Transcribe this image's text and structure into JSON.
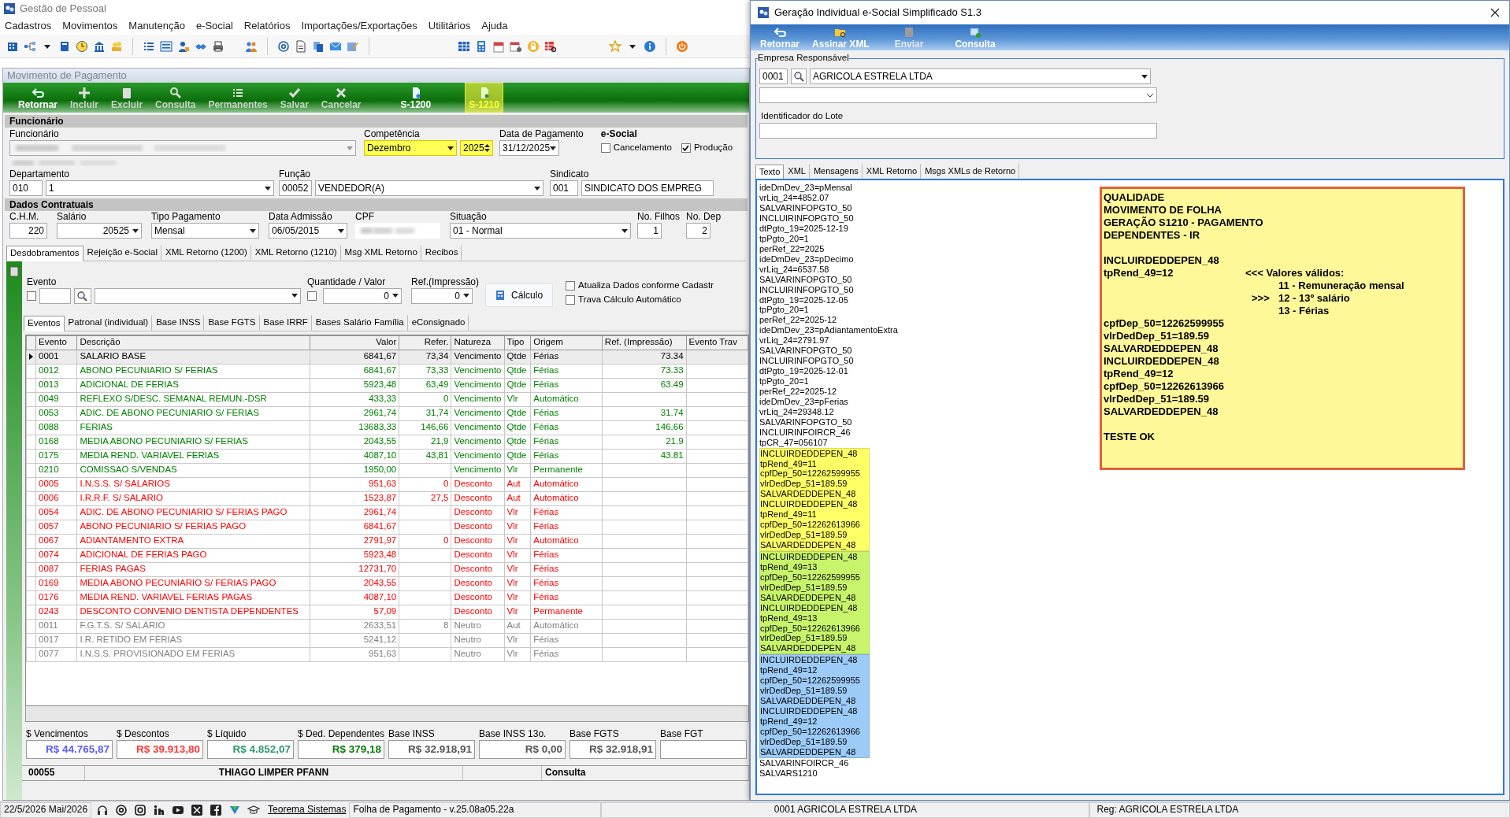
{
  "main_window": {
    "title": "Gestão de Pessoal"
  },
  "menu": [
    "Cadastros",
    "Movimentos",
    "Manutenção",
    "e-Social",
    "Relatórios",
    "Importações/Exportações",
    "Utilitários",
    "Ajuda"
  ],
  "child_window": {
    "title": "Movimento de Pagamento"
  },
  "toolbar": [
    {
      "label": "Retornar",
      "disabled": false,
      "highlighted": false
    },
    {
      "label": "Incluir",
      "disabled": true,
      "highlighted": false
    },
    {
      "label": "Excluir",
      "disabled": true,
      "highlighted": false
    },
    {
      "label": "Consulta",
      "disabled": true,
      "highlighted": false
    },
    {
      "label": "Permanentes",
      "disabled": true,
      "highlighted": false
    },
    {
      "label": "Salvar",
      "disabled": true,
      "highlighted": false
    },
    {
      "label": "Cancelar",
      "disabled": true,
      "highlighted": false
    },
    {
      "label": "S-1200",
      "disabled": false,
      "highlighted": false
    },
    {
      "label": "S-1210",
      "disabled": false,
      "highlighted": true
    }
  ],
  "funcionario": {
    "section": "Funcionário",
    "label": "Funcionário",
    "competencia": {
      "label": "Competência",
      "month": "Dezembro",
      "year": "2025",
      "highlighted": true
    },
    "data_pagamento": {
      "label": "Data de Pagamento",
      "value": "31/12/2025"
    },
    "esocial": {
      "label": "e-Social",
      "options": [
        {
          "label": "Cancelamento",
          "checked": false
        },
        {
          "label": "Produção",
          "checked": true
        }
      ]
    }
  },
  "lotacao": {
    "departamento": {
      "label": "Departamento",
      "code": "010",
      "name": "1"
    },
    "funcao": {
      "label": "Função",
      "code": "00052",
      "name": "VENDEDOR(A)"
    },
    "sindicato": {
      "label": "Sindicato",
      "code": "001",
      "name": "SINDICATO DOS EMPREG"
    }
  },
  "contrato": {
    "section": "Dados Contratuais",
    "chm": {
      "label": "C.H.M.",
      "value": "220"
    },
    "salario": {
      "label": "Salário",
      "value": "20525"
    },
    "tipo_pagamento": {
      "label": "Tipo Pagamento",
      "value": "Mensal"
    },
    "data_admissao": {
      "label": "Data Admissão",
      "value": "06/05/2015"
    },
    "cpf": {
      "label": "CPF"
    },
    "situacao": {
      "label": "Situação",
      "value": "01 - Normal"
    },
    "filhos": {
      "label": "No. Filhos",
      "value": "1"
    },
    "dependentes": {
      "label": "No. Dep",
      "value": "2"
    }
  },
  "tabs": [
    {
      "label": "Desdobramentos",
      "selected": true
    },
    {
      "label": "Rejeição e-Social",
      "selected": false
    },
    {
      "label": "XML Retorno (1200)",
      "selected": false
    },
    {
      "label": "XML Retorno (1210)",
      "selected": false
    },
    {
      "label": "Msg XML Retorno",
      "selected": false
    },
    {
      "label": "Recibos",
      "selected": false
    }
  ],
  "evento_panel": {
    "evento_label": "Evento",
    "evento_checked": false,
    "quantidade_label": "Quantidade / Valor",
    "quantidade_checked": false,
    "quantidade": "0",
    "ref_label": "Ref.(Impressão)",
    "ref": "0",
    "calc_button": "Cálculo",
    "options": [
      {
        "label": "Atualiza Dados conforme Cadastr",
        "checked": false
      },
      {
        "label": "Trava Cálculo Automático",
        "checked": false
      }
    ]
  },
  "sub_tabs": [
    {
      "label": "Eventos",
      "selected": true
    },
    {
      "label": "Patronal (individual)",
      "selected": false
    },
    {
      "label": "Base INSS",
      "selected": false
    },
    {
      "label": "Base FGTS",
      "selected": false
    },
    {
      "label": "Base IRRF",
      "selected": false
    },
    {
      "label": "Bases Salário Família",
      "selected": false
    },
    {
      "label": "eConsignado",
      "selected": false
    }
  ],
  "table": {
    "columns": [
      "Evento",
      "Descrição",
      "Valor",
      "Refer.",
      "Natureza",
      "Tipo",
      "Origem",
      "Ref. (Impressão)",
      "Evento Trav"
    ],
    "rows": [
      {
        "evento": "0001",
        "descricao": "SALARIO BASE",
        "valor": "6841,67",
        "refer": "73,34",
        "natureza": "Vencimento",
        "tipo": "Qtde",
        "origem": "Férias",
        "ref_impressao": "73.34",
        "color": "#000000",
        "selected": true
      },
      {
        "evento": "0012",
        "descricao": "ABONO PECUNIARIO S/ FERIAS",
        "valor": "6841,67",
        "refer": "73,33",
        "natureza": "Vencimento",
        "tipo": "Qtde",
        "origem": "Férias",
        "ref_impressao": "73.33",
        "color": "#008000",
        "selected": false
      },
      {
        "evento": "0013",
        "descricao": "ADICIONAL DE FERIAS",
        "valor": "5923,48",
        "refer": "63,49",
        "natureza": "Vencimento",
        "tipo": "Qtde",
        "origem": "Férias",
        "ref_impressao": "63.49",
        "color": "#008000",
        "selected": false
      },
      {
        "evento": "0049",
        "descricao": "REFLEXO S/DESC. SEMANAL REMUN.-DSR",
        "valor": "433,33",
        "refer": "0",
        "natureza": "Vencimento",
        "tipo": "Vlr",
        "origem": "Automático",
        "color": "#008000",
        "selected": false
      },
      {
        "evento": "0053",
        "descricao": "ADIC. DE ABONO PECUNIARIO S/ FERIAS",
        "valor": "2961,74",
        "refer": "31,74",
        "natureza": "Vencimento",
        "tipo": "Qtde",
        "origem": "Férias",
        "ref_impressao": "31.74",
        "color": "#008000",
        "selected": false
      },
      {
        "evento": "0088",
        "descricao": "FERIAS",
        "valor": "13683,33",
        "refer": "146,66",
        "natureza": "Vencimento",
        "tipo": "Qtde",
        "origem": "Férias",
        "ref_impressao": "146.66",
        "color": "#008000",
        "selected": false
      },
      {
        "evento": "0168",
        "descricao": "MEDIA ABONO PECUNIARIO S/ FERIAS",
        "valor": "2043,55",
        "refer": "21,9",
        "natureza": "Vencimento",
        "tipo": "Qtde",
        "origem": "Férias",
        "ref_impressao": "21.9",
        "color": "#008000",
        "selected": false
      },
      {
        "evento": "0175",
        "descricao": "MEDIA REND. VARIAVEL  FERIAS",
        "valor": "4087,10",
        "refer": "43,81",
        "natureza": "Vencimento",
        "tipo": "Qtde",
        "origem": "Férias",
        "ref_impressao": "43.81",
        "color": "#008000",
        "selected": false
      },
      {
        "evento": "0210",
        "descricao": "COMISSAO S/VENDAS",
        "valor": "1950,00",
        "natureza": "Vencimento",
        "tipo": "Vlr",
        "origem": "Permanente",
        "color": "#008000",
        "selected": false
      },
      {
        "evento": "0005",
        "descricao": "I.N.S.S. S/ SALARIOS",
        "valor": "951,63",
        "refer": "0",
        "natureza": "Desconto",
        "tipo": "Aut",
        "origem": "Automático",
        "color": "#ff0000",
        "selected": false
      },
      {
        "evento": "0006",
        "descricao": "I.R.R.F. S/ SALARIO",
        "valor": "1523,87",
        "refer": "27,5",
        "natureza": "Desconto",
        "tipo": "Aut",
        "origem": "Automático",
        "color": "#ff0000",
        "selected": false
      },
      {
        "evento": "0054",
        "descricao": "ADIC. DE ABONO PECUNIARIO S/ FERIAS PAGO",
        "valor": "2961,74",
        "natureza": "Desconto",
        "tipo": "Vlr",
        "origem": "Férias",
        "color": "#ff0000",
        "selected": false
      },
      {
        "evento": "0057",
        "descricao": "ABONO PECUNIARIO S/ FERIAS PAGO",
        "valor": "6841,67",
        "natureza": "Desconto",
        "tipo": "Vlr",
        "origem": "Férias",
        "color": "#ff0000",
        "selected": false
      },
      {
        "evento": "0067",
        "descricao": "ADIANTAMENTO EXTRA",
        "valor": "2791,97",
        "refer": "0",
        "natureza": "Desconto",
        "tipo": "Vlr",
        "origem": "Automático",
        "color": "#ff0000",
        "selected": false
      },
      {
        "evento": "0074",
        "descricao": "ADICIONAL DE FERIAS PAGO",
        "valor": "5923,48",
        "natureza": "Desconto",
        "tipo": "Vlr",
        "origem": "Férias",
        "color": "#ff0000",
        "selected": false
      },
      {
        "evento": "0087",
        "descricao": "FERIAS PAGAS",
        "valor": "12731,70",
        "natureza": "Desconto",
        "tipo": "Vlr",
        "origem": "Férias",
        "color": "#ff0000",
        "selected": false
      },
      {
        "evento": "0169",
        "descricao": "MEDIA ABONO PECUNIARIO S/ FERIAS PAGO",
        "valor": "2043,55",
        "natureza": "Desconto",
        "tipo": "Vlr",
        "origem": "Férias",
        "color": "#ff0000",
        "selected": false
      },
      {
        "evento": "0176",
        "descricao": "MEDIA REND. VARIAVEL  FERIAS PAGAS",
        "valor": "4087,10",
        "natureza": "Desconto",
        "tipo": "Vlr",
        "origem": "Férias",
        "color": "#ff0000",
        "selected": false
      },
      {
        "evento": "0243",
        "descricao": "DESCONTO CONVENIO DENTISTA DEPENDENTES",
        "valor": "57,09",
        "natureza": "Desconto",
        "tipo": "Vlr",
        "origem": "Permanente",
        "color": "#ff0000",
        "selected": false
      },
      {
        "evento": "0011",
        "descricao": "F.G.T.S. S/ SALÁRIO",
        "valor": "2633,51",
        "refer": "8",
        "natureza": "Neutro",
        "tipo": "Aut",
        "origem": "Automático",
        "color": "#808080",
        "selected": false
      },
      {
        "evento": "0017",
        "descricao": "I.R. RETIDO EM FÉRIAS",
        "valor": "5241,12",
        "natureza": "Neutro",
        "tipo": "Vlr",
        "origem": "Férias",
        "color": "#808080",
        "selected": false
      },
      {
        "evento": "0077",
        "descricao": "I.N.S.S. PROVISIONADO EM FERIAS",
        "valor": "951,63",
        "natureza": "Neutro",
        "tipo": "Vlr",
        "origem": "Férias",
        "color": "#808080",
        "selected": false
      }
    ]
  },
  "totals": [
    {
      "label": "$ Vencimentos",
      "value": "R$ 44.765,87",
      "color": "#5b5bff"
    },
    {
      "label": "$ Descontos",
      "value": "R$ 39.913,80",
      "color": "#ff3b3b"
    },
    {
      "label": "$ Líquido",
      "value": "R$ 4.852,07",
      "color": "#2f9a6c"
    },
    {
      "label": "$ Ded. Dependentes",
      "value": "R$ 379,18",
      "color": "#0a7a0a"
    },
    {
      "label": "Base INSS",
      "value": "R$ 32.918,91",
      "color": "#555555"
    },
    {
      "label": "Base INSS 13o.",
      "value": "R$ 0,00",
      "color": "#555555"
    },
    {
      "label": "Base FGTS",
      "value": "R$ 32.918,91",
      "color": "#555555"
    },
    {
      "label": "Base FGT"
    }
  ],
  "employee_bar": {
    "code": "00055",
    "name": "THIAGO LIMPER PFANN",
    "mode": "Consulta"
  },
  "status_bar": {
    "date": "22/5/2026 Mai/2026",
    "link": "Teorema Sistemas",
    "version": "Folha de Pagamento - v.25.08a05.22a",
    "company": "0001 AGRICOLA ESTRELA LTDA",
    "reg": "Reg: AGRICOLA ESTRELA LTDA"
  },
  "dialog": {
    "title": "Geração Individual e-Social Simplificado S1.3",
    "toolbar": [
      {
        "label": "Retornar",
        "disabled": false
      },
      {
        "label": "Assinar XML",
        "disabled": false
      },
      {
        "label": "Enviar",
        "disabled": true
      },
      {
        "label": "Consulta",
        "disabled": false
      }
    ],
    "empresa": {
      "legend": "Empresa Responsável",
      "code": "0001",
      "name": "AGRICOLA ESTRELA LTDA"
    },
    "lote": {
      "label": "Identificador do Lote"
    },
    "tabs": [
      {
        "label": "Texto",
        "selected": true
      },
      {
        "label": "XML",
        "selected": false
      },
      {
        "label": "Mensagens",
        "selected": false
      },
      {
        "label": "XML Retorno",
        "selected": false
      },
      {
        "label": "Msgs XMLs de Retorno",
        "selected": false
      }
    ],
    "log": [
      {
        "lines": [
          "ideDmDev_23=pMensal",
          "vrLiq_24=4852.07",
          "SALVARINFOPGTO_50",
          "INCLUIRINFOPGTO_50",
          "dtPgto_19=2025-12-19",
          "tpPgto_20=1",
          "perRef_22=2025",
          "ideDmDev_23=pDecimo",
          "vrLiq_24=6537.58",
          "SALVARINFOPGTO_50",
          "INCLUIRINFOPGTO_50",
          "dtPgto_19=2025-12-05",
          "tpPgto_20=1",
          "perRef_22=2025-12",
          "ideDmDev_23=pAdiantamentoExtra",
          "vrLiq_24=2791.97",
          "SALVARINFOPGTO_50",
          "INCLUIRINFOPGTO_50",
          "dtPgto_19=2025-12-01",
          "tpPgto_20=1",
          "perRef_22=2025-12",
          "ideDmDev_23=pFerias",
          "vrLiq_24=29348.12",
          "SALVARINFOPGTO_50",
          "INCLUIRINFOIRCR_46",
          "tpCR_47=056107"
        ]
      },
      {
        "color": "#ffff66",
        "lines": [
          "INCLUIRDEDDEPEN_48",
          "tpRend_49=11",
          "cpfDep_50=12262599955",
          "vlrDedDep_51=189.59",
          "SALVARDEDDEPEN_48",
          "INCLUIRDEDDEPEN_48",
          "tpRend_49=11",
          "cpfDep_50=12262613966",
          "vlrDedDep_51=189.59",
          "SALVARDEDDEPEN_48"
        ]
      },
      {
        "color": "#c8f46c",
        "lines": [
          "INCLUIRDEDDEPEN_48",
          "tpRend_49=13",
          "cpfDep_50=12262599955",
          "vlrDedDep_51=189.59",
          "SALVARDEDDEPEN_48",
          "INCLUIRDEDDEPEN_48",
          "tpRend_49=13",
          "cpfDep_50=12262613966",
          "vlrDedDep_51=189.59",
          "SALVARDEDDEPEN_48"
        ]
      },
      {
        "color": "#9ccbf8",
        "lines": [
          "INCLUIRDEDDEPEN_48",
          "tpRend_49=12",
          "cpfDep_50=12262599955",
          "vlrDedDep_51=189.59",
          "SALVARDEDDEPEN_48",
          "INCLUIRDEDDEPEN_48",
          "tpRend_49=12",
          "cpfDep_50=12262613966",
          "vlrDedDep_51=189.59",
          "SALVARDEDDEPEN_48"
        ]
      },
      {
        "lines": [
          "SALVARINFOIRCR_46",
          "SALVARS1210"
        ]
      }
    ],
    "note": {
      "header": [
        "QUALIDADE",
        "MOVIMENTO DE FOLHA",
        "GERAÇÃO S1210 - PAGAMENTO",
        "DEPENDENTES - IR"
      ],
      "body_top": [
        "INCLUIRDEDDEPEN_48"
      ],
      "rend_line": "tpRend_49=12",
      "legend": {
        "title": "<<< Valores válidos:",
        "options": [
          {
            "text": "11 - Remuneração mensal"
          },
          {
            "text": "12 - 13º salário",
            "pointer": ">>>"
          },
          {
            "text": "13 - Férias"
          }
        ]
      },
      "body": [
        "cpfDep_50=12262599955",
        "vlrDedDep_51=189.59",
        "SALVARDEDDEPEN_48",
        "INCLUIRDEDDEPEN_48",
        "tpRend_49=12",
        "cpfDep_50=12262613966",
        "vlrDedDep_51=189.59",
        "SALVARDEDDEPEN_48"
      ],
      "footer": "TESTE OK"
    }
  }
}
